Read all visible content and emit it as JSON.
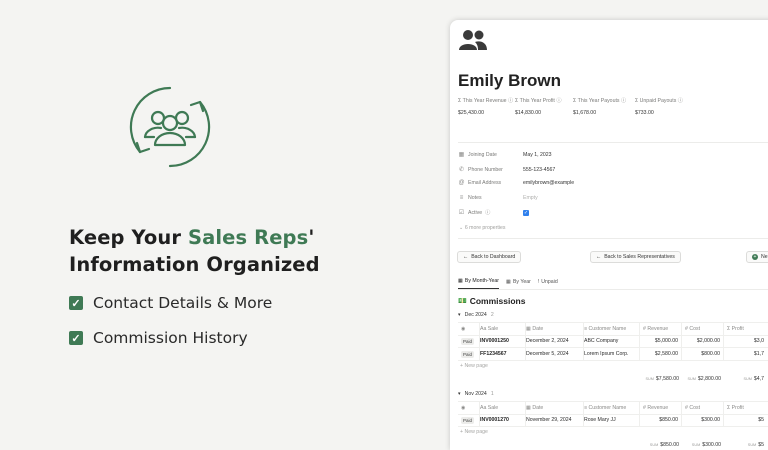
{
  "promo": {
    "headline_part1": "Keep Your ",
    "headline_accent": "Sales Reps",
    "headline_part2": "'",
    "headline_line2": "Information Organized",
    "features": [
      "Contact Details & More",
      "Commission History"
    ],
    "accent_color": "#3f7a55"
  },
  "record": {
    "title": "Emily Brown",
    "icon": "people-icon",
    "stats": [
      {
        "label": "This Year Revenue",
        "value": "$25,430.00"
      },
      {
        "label": "This Year Profit",
        "value": "$14,830.00"
      },
      {
        "label": "This Year Payouts",
        "value": "$1,678.00"
      },
      {
        "label": "Unpaid Payouts",
        "value": "$733.00"
      }
    ],
    "properties": {
      "joining_date": {
        "label": "Joining Date",
        "value": "May 1, 2023"
      },
      "phone": {
        "label": "Phone Number",
        "value": "555-123-4567"
      },
      "email": {
        "label": "Email Address",
        "value": "emilybrown@example"
      },
      "notes": {
        "label": "Notes",
        "value": "Empty"
      },
      "active": {
        "label": "Active",
        "value": true
      }
    },
    "more_properties": "6 more properties"
  },
  "buttons": {
    "back_dashboard": "Back to Dashboard",
    "back_reps": "Back to Sales Representatives",
    "new": "Ne"
  },
  "tabs": [
    "By Month-Year",
    "By Year",
    "Unpaid"
  ],
  "commissions": {
    "title": "Commissions",
    "columns": [
      "Aa Sale",
      "Date",
      "Customer Name",
      "Revenue",
      "Cost",
      "Profit"
    ],
    "new_page": "New page",
    "sum_label": "SUM",
    "groups": [
      {
        "name": "Dec 2024",
        "count": "2",
        "rows": [
          {
            "status": "Paid",
            "sale": "INV0001250",
            "date": "December 2, 2024",
            "customer": "ABC Company",
            "revenue": "$5,000.00",
            "cost": "$2,000.00",
            "profit": "$3,0"
          },
          {
            "status": "Paid",
            "sale": "FF1234567",
            "date": "December 5, 2024",
            "customer": "Lorem Ipsum Corp.",
            "revenue": "$2,580.00",
            "cost": "$800.00",
            "profit": "$1,7"
          }
        ],
        "sums": {
          "revenue": "$7,580.00",
          "cost": "$2,800.00",
          "profit": "$4,7"
        }
      },
      {
        "name": "Nov 2024",
        "count": "1",
        "rows": [
          {
            "status": "Paid",
            "sale": "INV0001270",
            "date": "November 29, 2024",
            "customer": "Rose Mary JJ",
            "revenue": "$850.00",
            "cost": "$300.00",
            "profit": "$5"
          }
        ],
        "sums": {
          "revenue": "$850.00",
          "cost": "$300.00",
          "profit": "$5"
        }
      }
    ]
  }
}
